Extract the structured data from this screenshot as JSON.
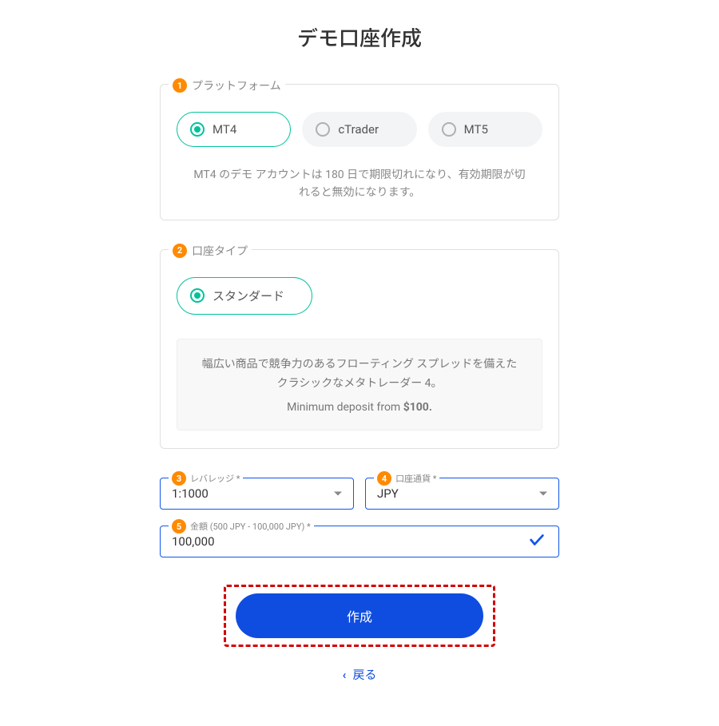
{
  "title": "デモ口座作成",
  "sections": {
    "platform": {
      "step": "1",
      "label": "プラットフォーム",
      "options": {
        "mt4": "MT4",
        "ctrader": "cTrader",
        "mt5": "MT5"
      },
      "help_text": "MT4 のデモ アカウントは 180 日で期限切れになり、有効期限が切れると無効になります。"
    },
    "account_type": {
      "step": "2",
      "label": "口座タイプ",
      "options": {
        "standard": "スタンダード"
      },
      "info": {
        "desc": "幅広い商品で競争力のあるフローティング スプレッドを備えたクラシックなメタトレーダー 4。",
        "deposit_prefix": "Minimum deposit from ",
        "deposit_amount": "$100.",
        "deposit_suffix": ""
      }
    },
    "leverage": {
      "step": "3",
      "label": "レバレッジ *",
      "value": "1:1000"
    },
    "currency": {
      "step": "4",
      "label": "口座通貨 *",
      "value": "JPY"
    },
    "amount": {
      "step": "5",
      "label": "金額 (500 JPY - 100,000 JPY) *",
      "value": "100,000"
    }
  },
  "buttons": {
    "submit": "作成",
    "back": "戻る"
  }
}
